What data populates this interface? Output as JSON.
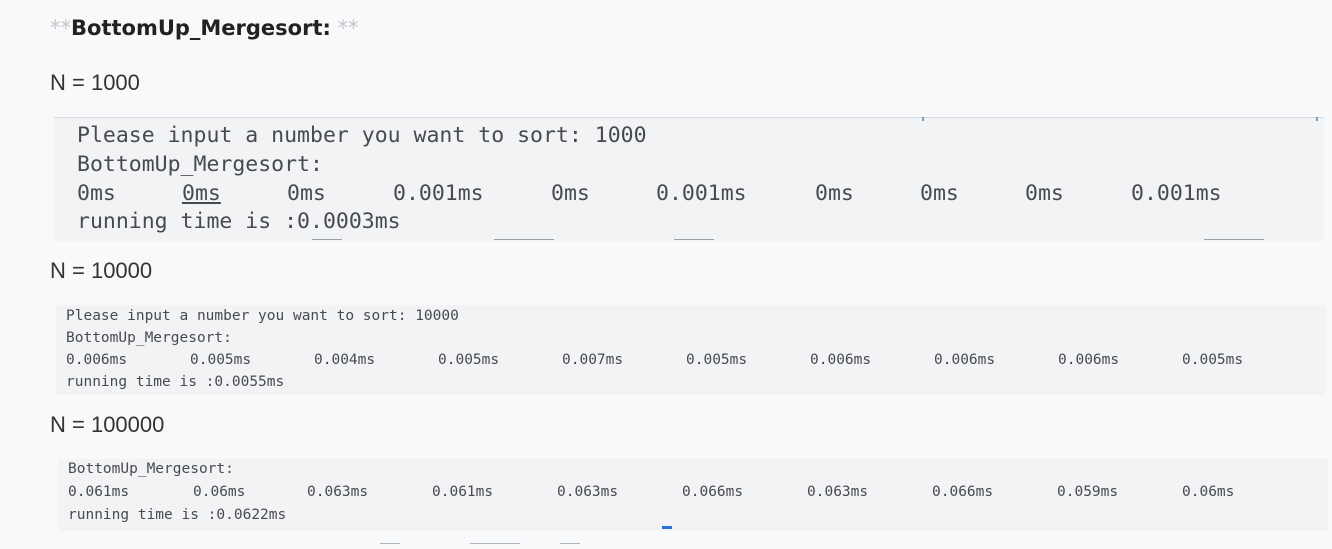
{
  "heading": {
    "md_prefix": "**",
    "title": "BottomUp_Mergesort:",
    "md_suffix": " **"
  },
  "sections": [
    {
      "n_label": "N = 1000",
      "prompt_line": "Please input a number you want to sort: 1000",
      "algo_line": "BottomUp_Mergesort:",
      "times": [
        "0ms",
        "0ms",
        "0ms",
        "0.001ms",
        "0ms",
        "0.001ms",
        "0ms",
        "0ms",
        "0ms",
        "0.001ms"
      ],
      "running": "running time is :0.0003ms"
    },
    {
      "n_label": "N = 10000",
      "prompt_line": "Please input a number you want to sort: 10000",
      "algo_line": "BottomUp_Mergesort:",
      "times": [
        "0.006ms",
        "0.005ms",
        "0.004ms",
        "0.005ms",
        "0.007ms",
        "0.005ms",
        "0.006ms",
        "0.006ms",
        "0.006ms",
        "0.005ms"
      ],
      "running": "running time is :0.0055ms"
    },
    {
      "n_label": "N = 100000",
      "algo_line": "BottomUp_Mergesort:",
      "times": [
        "0.061ms",
        "0.06ms",
        "0.063ms",
        "0.061ms",
        "0.063ms",
        "0.066ms",
        "0.063ms",
        "0.066ms",
        "0.059ms",
        "0.06ms"
      ],
      "running": "running time is :0.0622ms"
    }
  ]
}
